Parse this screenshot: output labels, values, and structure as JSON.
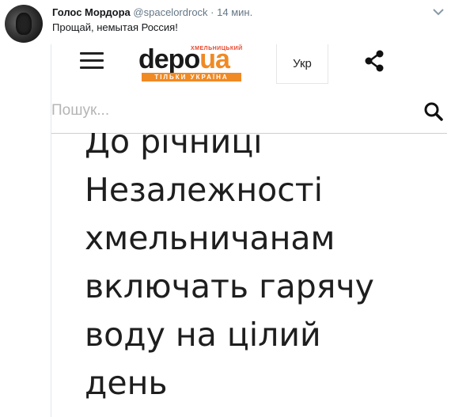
{
  "tweet": {
    "author": "Голос Мордора",
    "handle": "@spacelordrock",
    "separator": "·",
    "time": "14 мин.",
    "text": "Прощай, немытая Россия!"
  },
  "site": {
    "logo_top": "ХМЕЛЬНИЦЬКИЙ",
    "logo_main": "depo",
    "logo_domain": "ua",
    "logo_bottom": "ТІЛЬКИ УКРАЇНА",
    "lang": "Укр",
    "search": {
      "placeholder": "Пошук..."
    },
    "headline": [
      "До річниці",
      "Незалежності",
      "хмельничанам",
      "включать гарячу",
      "воду на цілий",
      "день"
    ]
  },
  "colors": {
    "accent": "#f08a24",
    "logo_red": "#e8462a",
    "muted": "#657786"
  },
  "icons": [
    "avatar",
    "caret-down-icon",
    "hamburger-menu-icon",
    "share-icon",
    "search-icon"
  ]
}
